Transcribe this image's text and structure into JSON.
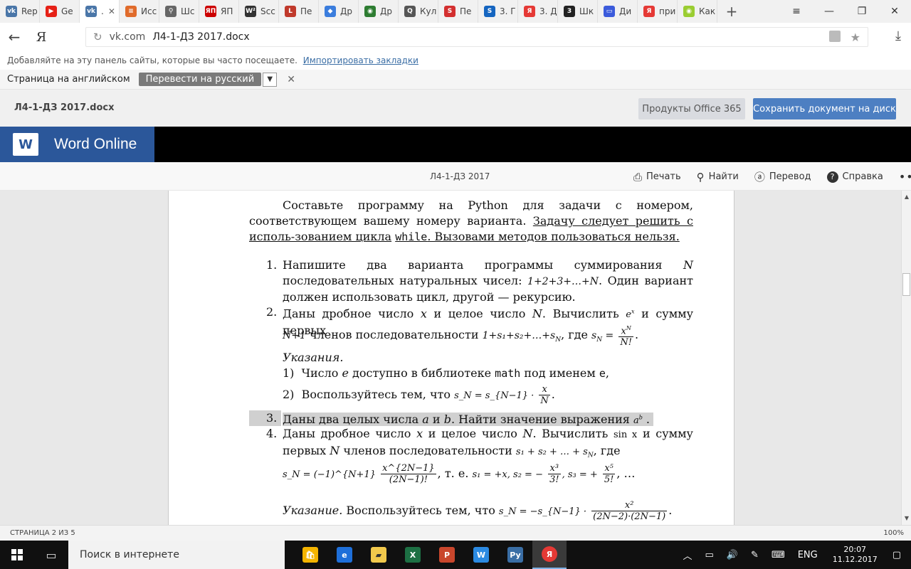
{
  "tabs": [
    {
      "label": "Rep",
      "icon": "vk-icon",
      "color": "#4a76a8",
      "glyph": "vk"
    },
    {
      "label": "Ge",
      "icon": "youtube-icon",
      "color": "#e62117",
      "glyph": "▶"
    },
    {
      "label": ".",
      "icon": "vk-icon",
      "color": "#4a76a8",
      "glyph": "vk",
      "active": true
    },
    {
      "label": "Исс",
      "icon": "stack-icon",
      "color": "#e06b2b",
      "glyph": "≡"
    },
    {
      "label": "Шс",
      "icon": "link-icon",
      "color": "#666666",
      "glyph": "⚲"
    },
    {
      "label": "ЯП",
      "icon": "yap-icon",
      "color": "#cc0000",
      "glyph": "ЯП"
    },
    {
      "label": "Scс",
      "icon": "w2-icon",
      "color": "#333333",
      "glyph": "W²"
    },
    {
      "label": "Пе",
      "icon": "l-icon",
      "color": "#c0392b",
      "glyph": "L"
    },
    {
      "label": "Др",
      "icon": "diamond-icon",
      "color": "#3b7ddd",
      "glyph": "◆"
    },
    {
      "label": "Др",
      "icon": "globe-icon",
      "color": "#2e7d32",
      "glyph": "◉"
    },
    {
      "label": "Кул",
      "icon": "search-icon",
      "color": "#555555",
      "glyph": "Q"
    },
    {
      "label": "Пе",
      "icon": "s-icon",
      "color": "#d32f2f",
      "glyph": "S"
    },
    {
      "label": "3. Г",
      "icon": "s-icon",
      "color": "#1565c0",
      "glyph": "S"
    },
    {
      "label": "3. Д",
      "icon": "yandex-icon",
      "color": "#e53935",
      "glyph": "Я"
    },
    {
      "label": "Шк",
      "icon": "three-icon",
      "color": "#222222",
      "glyph": "3"
    },
    {
      "label": "Ди",
      "icon": "chat-icon",
      "color": "#3b5bdb",
      "glyph": "▭"
    },
    {
      "label": "при",
      "icon": "yandex-icon",
      "color": "#e53935",
      "glyph": "Я"
    },
    {
      "label": "Как",
      "icon": "speech-icon",
      "color": "#9acd32",
      "glyph": "◉"
    }
  ],
  "address": {
    "yandex_logo": "Я",
    "domain": "vk.com",
    "title": "Л4-1-ДЗ 2017.docx"
  },
  "bookmarks_hint": {
    "text": "Добавляйте на эту панель сайты, которые вы часто посещаете.",
    "link": "Импортировать закладки"
  },
  "translate_bar": {
    "label": "Страница на английском",
    "button": "Перевести на русский"
  },
  "doc_header": {
    "name": "Л4-1-ДЗ 2017.docx",
    "office_button": "Продукты Office 365",
    "save_button": "Сохранить документ на диск"
  },
  "word_online": {
    "logo_letter": "W",
    "title": "Word Online"
  },
  "viewer": {
    "doc_title": "Л4-1-ДЗ 2017",
    "print": "Печать",
    "find": "Найти",
    "translate": "Перевод",
    "help": "Справка"
  },
  "document": {
    "intro_plain": "Составьте программу на Python для задачи с номером, соответствующем вашему номеру варианта.",
    "intro_underlined_1": "Задачу следует решить с исполь-зованием цикла",
    "intro_code": "while",
    "intro_underlined_2": ". Вызовами методов пользоваться нельзя.",
    "item1_num": "1.",
    "item1_a": "Напишите два варианта программы суммирования",
    "item1_N": "N",
    "item1_b": "последовательных натуральных чисел:",
    "item1_formula": "1+2+3+…+N",
    "item1_c": ". Один вариант должен использовать цикл, другой — рекурсию.",
    "item2_num": "2.",
    "item2_a": "Даны дробное число",
    "item2_x": "x",
    "item2_b": "и целое число",
    "item2_N": "N",
    "item2_c": ". Вычислить",
    "item2_ex": "e",
    "item2_ex_sup": "x",
    "item2_d": "и сумму первых",
    "item2_f1": "N+1",
    "item2_e": "членов последовательности",
    "item2_f2": "1+s₁+s₂+…+s",
    "item2_f2_sub": "N",
    "item2_where": ", где",
    "item2_sN": "s",
    "item2_sN_sub": "N",
    "item2_frac_top": "x",
    "item2_frac_top_sup": "N",
    "item2_frac_bot": "N!",
    "hints_title": "Указания.",
    "hint1_num": "1)",
    "hint1_a": "Число",
    "hint1_e": "e",
    "hint1_b": "доступно в библиотеке",
    "hint1_math": "math",
    "hint1_c": "под именем",
    "hint1_code": "e",
    "hint1_d": ",",
    "hint2_num": "2)",
    "hint2_a": "Воспользуйтесь тем, что",
    "hint2_formula": "s_N = s_{N−1} ·",
    "hint2_frac_top": "x",
    "hint2_frac_bot": "N",
    "item3_num": "3.",
    "item3_a": "Даны два целых числа",
    "item3_a_var": "a",
    "item3_and": "и",
    "item3_b_var": "b",
    "item3_b": ". Найти значение выражения",
    "item3_expr": "a",
    "item3_expr_sup": "b",
    "item4_num": "4.",
    "item4_a": "Даны дробное число",
    "item4_x": "x",
    "item4_b": "и целое число",
    "item4_N": "N",
    "item4_c": ". Вычислить",
    "item4_sin": "sin x",
    "item4_d": "и сумму первых",
    "item4_N2": "N",
    "item4_e": "членов последовательности",
    "item4_series": "s₁ + s₂ + … + s",
    "item4_series_sub": "N",
    "item4_where": ", где",
    "item4_formula": "s_N = (−1)^{N+1}",
    "item4_frac_top": "x^{2N−1}",
    "item4_frac_bot": "(2N−1)!",
    "item4_ie": ", т. е.",
    "item4_terms": "s₁ = +x, s₂ = −",
    "item4_t2_top": "x³",
    "item4_t2_bot": "3!",
    "item4_terms2": ", s₃ = +",
    "item4_t3_top": "x⁵",
    "item4_t3_bot": "5!",
    "item4_terms3": ", …",
    "item4_hint": "Указание.",
    "item4_hint_text": "Воспользуйтесь тем, что",
    "item4_hint_formula": "s_N = −s_{N−1} ·",
    "item4_hint_top": "x²",
    "item4_hint_bot": "(2N−2)·(2N−1)",
    "item4_hint_end": "."
  },
  "status": {
    "page": "СТРАНИЦА 2 ИЗ 5",
    "zoom": "100%"
  },
  "taskbar": {
    "search_placeholder": "Поиск в интернете",
    "lang": "ENG",
    "time": "20:07",
    "date": "11.12.2017"
  }
}
